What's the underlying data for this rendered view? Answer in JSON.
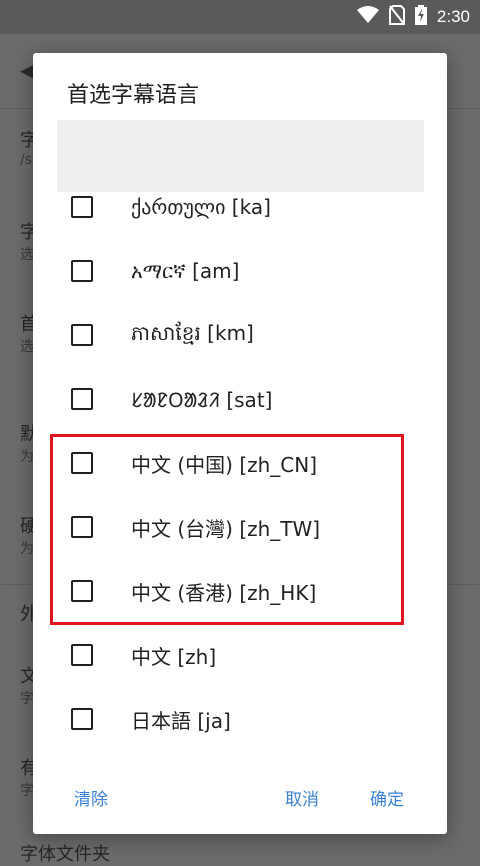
{
  "status_bar": {
    "time": "2:30",
    "icons": [
      "wifi-icon",
      "no-sim-icon",
      "battery-charging-icon"
    ]
  },
  "background_page": {
    "back_icon": "back-arrow-icon",
    "rows": [
      {
        "title": "字",
        "subtitle": "/s"
      },
      {
        "title": "字",
        "subtitle": "选"
      },
      {
        "title": "首",
        "subtitle": "选"
      },
      {
        "title": "默",
        "subtitle": "为"
      },
      {
        "title": "硬",
        "subtitle": "为"
      },
      {
        "title": "外",
        "subtitle": ""
      },
      {
        "title": "文",
        "subtitle": "字"
      },
      {
        "title": "有",
        "subtitle": "字"
      },
      {
        "title": "字体文件夹",
        "subtitle": ""
      }
    ]
  },
  "dialog": {
    "title": "首选字幕语言",
    "search_value": "",
    "items": [
      {
        "label": "ქართული [ka]",
        "checked": false
      },
      {
        "label": "አማርኛ [am]",
        "checked": false
      },
      {
        "label": "ភាសាខ្មែរ [km]",
        "checked": false
      },
      {
        "label": "ᱥᱟᱱᱛᱟᱲᱤ [sat]",
        "checked": false
      },
      {
        "label": "中文 (中国) [zh_CN]",
        "checked": false
      },
      {
        "label": "中文 (台灣) [zh_TW]",
        "checked": false
      },
      {
        "label": "中文 (香港) [zh_HK]",
        "checked": false
      },
      {
        "label": "中文 [zh]",
        "checked": false
      },
      {
        "label": "日本語 [ja]",
        "checked": false
      }
    ],
    "buttons": {
      "clear": "清除",
      "cancel": "取消",
      "ok": "确定"
    },
    "highlight_color": "#e0161e",
    "accent_color": "#3b82d6"
  }
}
